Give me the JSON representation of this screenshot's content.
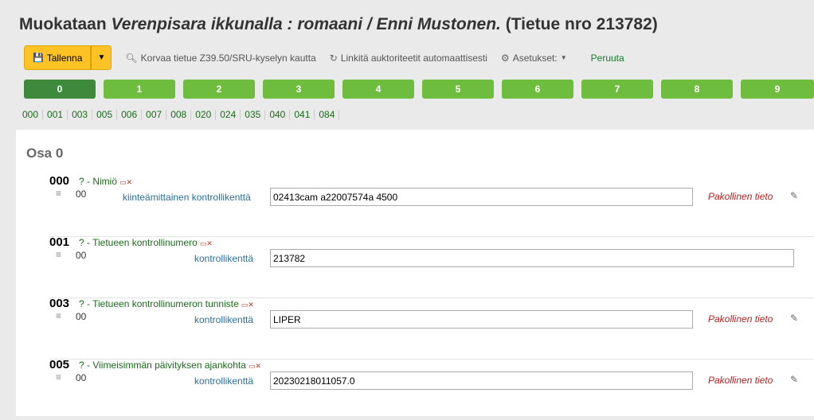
{
  "title": {
    "prefix": "Muokataan ",
    "record_title": "Verenpisara ikkunalla : romaani / Enni Mustonen.",
    "suffix": " (Tietue nro 213782)"
  },
  "toolbar": {
    "save_label": "Tallenna",
    "replace_label": "Korvaa tietue Z39.50/SRU-kyselyn kautta",
    "link_label": "Linkitä auktoriteetit automaattisesti",
    "settings_label": "Asetukset:",
    "cancel_label": "Peruuta"
  },
  "tabs": [
    "0",
    "1",
    "2",
    "3",
    "4",
    "5",
    "6",
    "7",
    "8",
    "9"
  ],
  "field_links": [
    "000",
    "001",
    "003",
    "005",
    "006",
    "007",
    "008",
    "020",
    "024",
    "035",
    "040",
    "041",
    "084"
  ],
  "section": {
    "title": "Osa 0"
  },
  "tags": [
    {
      "tag": "000",
      "desc": "? - Nimiö",
      "indicators": "00",
      "sublabel": "kiinteämittainen kontrollikenttä",
      "value": "02413cam a22007574a 4500",
      "required": "Pakollinen tieto"
    },
    {
      "tag": "001",
      "desc": "? - Tietueen kontrollinumero",
      "indicators": "00",
      "sublabel": "kontrollikenttä",
      "value": "213782",
      "required": ""
    },
    {
      "tag": "003",
      "desc": "? - Tietueen kontrollinumeron tunniste",
      "indicators": "00",
      "sublabel": "kontrollikenttä",
      "value": "LIPER",
      "required": "Pakollinen tieto"
    },
    {
      "tag": "005",
      "desc": "? - Viimeisimmän päivityksen ajankohta",
      "indicators": "00",
      "sublabel": "kontrollikenttä",
      "value": "20230218011057.0",
      "required": "Pakollinen tieto"
    }
  ],
  "icons": {
    "save": "floppy-disk-icon",
    "search": "search-icon",
    "refresh": "refresh-icon",
    "settings": "gear-icon",
    "delete": "delete-tag-icon",
    "drag": "drag-handle-icon",
    "edit": "edit-icon"
  },
  "colors": {
    "save_button": "#ffc325",
    "tab": "#6ebd3f",
    "tab_active": "#3d8a3d",
    "required_text": "#b21f1f",
    "link_green": "#1b6a1b"
  }
}
